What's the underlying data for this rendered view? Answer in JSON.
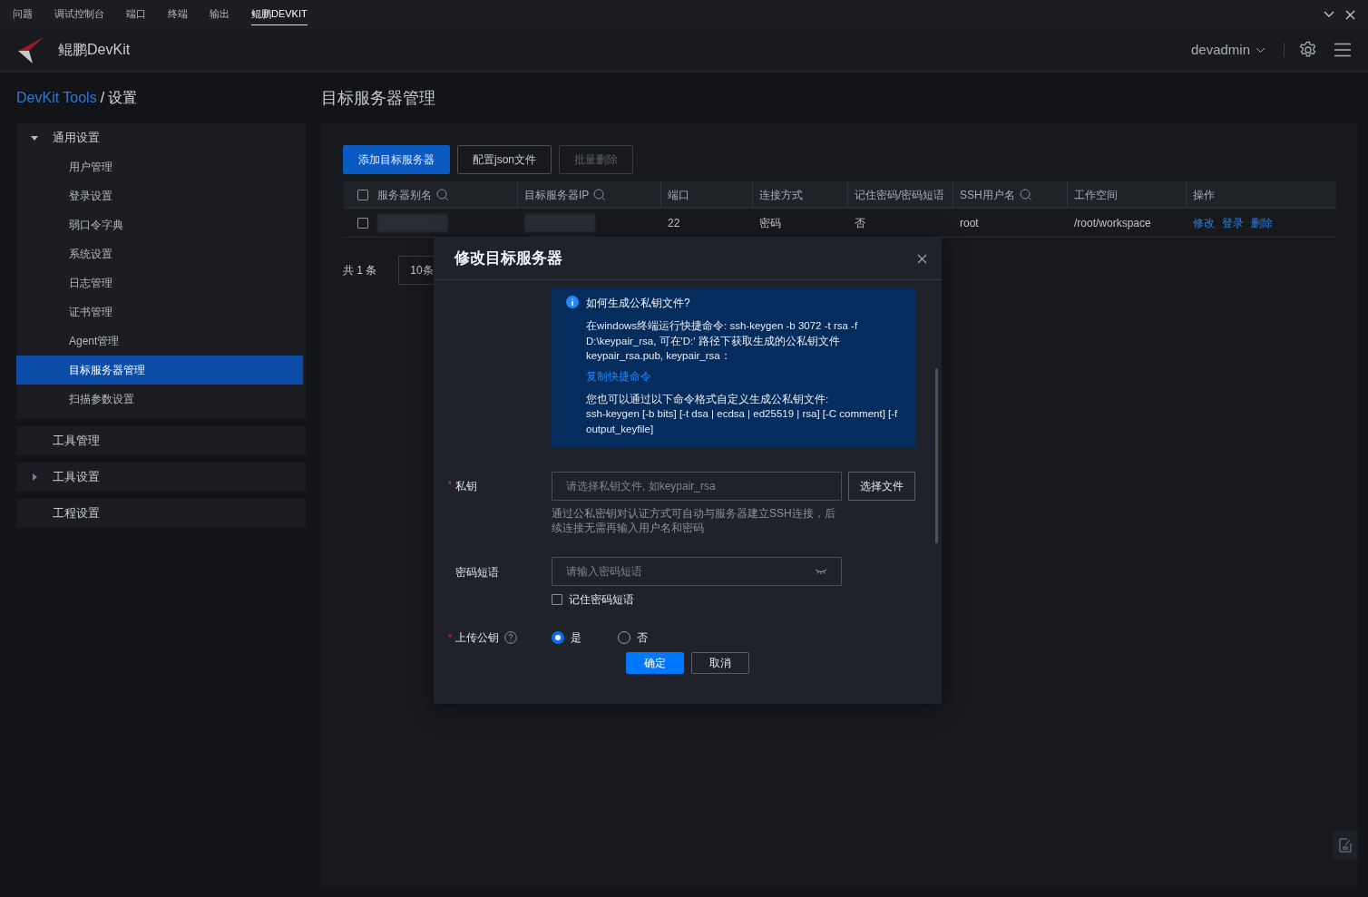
{
  "panel_tabs": [
    {
      "label": "问题",
      "selected": false
    },
    {
      "label": "调试控制台",
      "selected": false
    },
    {
      "label": "端口",
      "selected": false
    },
    {
      "label": "终端",
      "selected": false
    },
    {
      "label": "输出",
      "selected": false
    },
    {
      "label": "鲲鹏DEVKIT",
      "selected": true
    }
  ],
  "app": {
    "title": "鲲鹏DevKit",
    "user": "devadmin"
  },
  "breadcrumb": {
    "root": "DevKit Tools",
    "separator": "/",
    "current": "设置"
  },
  "page_title": "目标服务器管理",
  "sidebar": [
    {
      "label": "通用设置",
      "expanded": true,
      "children": [
        {
          "label": "用户管理",
          "selected": false
        },
        {
          "label": "登录设置",
          "selected": false
        },
        {
          "label": "弱口令字典",
          "selected": false
        },
        {
          "label": "系统设置",
          "selected": false
        },
        {
          "label": "日志管理",
          "selected": false
        },
        {
          "label": "证书管理",
          "selected": false
        },
        {
          "label": "Agent管理",
          "selected": false
        },
        {
          "label": "目标服务器管理",
          "selected": true
        },
        {
          "label": "扫描参数设置",
          "selected": false
        }
      ]
    },
    {
      "label": "工具管理"
    },
    {
      "label": "工具设置",
      "expanded": false
    },
    {
      "label": "工程设置"
    }
  ],
  "toolbar": [
    {
      "label": "添加目标服务器",
      "kind": "primary",
      "disabled": false
    },
    {
      "label": "配置json文件",
      "kind": "secondary",
      "disabled": false
    },
    {
      "label": "批量删除",
      "kind": "secondary",
      "disabled": true
    }
  ],
  "table": {
    "select_all": {
      "checked": false
    },
    "columns": [
      {
        "label": "服务器别名",
        "kind": "searchable"
      },
      {
        "label": "目标服务器IP",
        "kind": "searchable"
      },
      {
        "label": "端口",
        "kind": "plain"
      },
      {
        "label": "连接方式",
        "kind": "plain"
      },
      {
        "label": "记住密码/密码短语",
        "kind": "plain"
      },
      {
        "label": "SSH用户名",
        "kind": "searchable"
      },
      {
        "label": "工作空间",
        "kind": "plain"
      },
      {
        "label": "操作",
        "kind": "plain"
      }
    ],
    "rows": [
      {
        "checked": false,
        "cells": [
          {
            "kind": "redacted"
          },
          {
            "kind": "redacted"
          },
          {
            "kind": "text",
            "text": "22"
          },
          {
            "kind": "text",
            "text": "密码"
          },
          {
            "kind": "text",
            "text": "否"
          },
          {
            "kind": "text",
            "text": "root"
          },
          {
            "kind": "text",
            "text": "/root/workspace"
          },
          {
            "kind": "actions",
            "links": [
              "修改",
              "登录",
              "删除"
            ]
          }
        ]
      }
    ]
  },
  "pagination": {
    "total": "共 1 条",
    "page_size": "10条"
  },
  "dialog": {
    "title": "修改目标服务器",
    "info": {
      "title": "如何生成公私钥文件?",
      "text": "在windows终端运行快捷命令: ssh-keygen -b 3072 -t rsa -f D:\\keypair_rsa, 可在'D:' 路径下获取生成的公私钥文件keypair_rsa.pub, keypair_rsa：",
      "link": "复制快捷命令",
      "text2": "您也可以通过以下命令格式自定义生成公私钥文件:",
      "text3": "ssh-keygen [-b bits] [-t dsa | ecdsa | ed25519 | rsa] [-C comment] [-f output_keyfile]"
    },
    "private_key": {
      "label": "私钥",
      "required_mark": "*",
      "placeholder": "请选择私钥文件, 如keypair_rsa",
      "button": "选择文件",
      "hint": "通过公私密钥对认证方式可自动与服务器建立SSH连接，后续连接无需再输入用户名和密码"
    },
    "passphrase": {
      "label": "密码短语",
      "placeholder": "请输入密码短语",
      "remember": {
        "label": "记住密码短语",
        "checked": false
      }
    },
    "upload_key": {
      "label": "上传公钥",
      "required_mark": "*",
      "options": [
        {
          "label": "是",
          "selected": true
        },
        {
          "label": "否",
          "selected": false
        }
      ]
    },
    "buttons": [
      {
        "label": "确定",
        "kind": "primary"
      },
      {
        "label": "取消",
        "kind": "secondary"
      }
    ]
  }
}
